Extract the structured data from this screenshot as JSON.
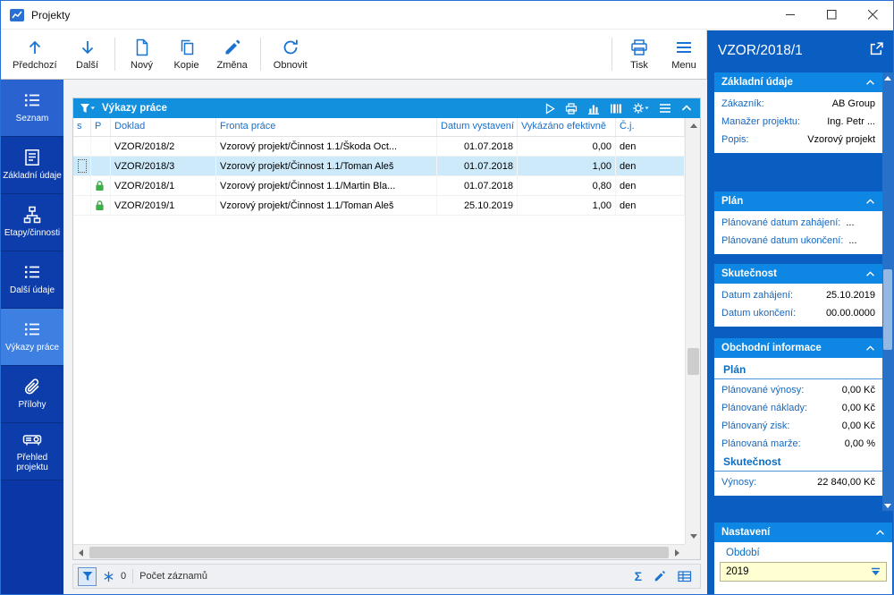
{
  "window": {
    "title": "Projekty"
  },
  "toolbar": {
    "prev_label": "Předchozí",
    "next_label": "Další",
    "new_label": "Nový",
    "copy_label": "Kopie",
    "change_label": "Změna",
    "refresh_label": "Obnovit",
    "print_label": "Tisk",
    "menu_label": "Menu"
  },
  "sidebar": {
    "items": [
      {
        "label": "Seznam"
      },
      {
        "label": "Základní údaje"
      },
      {
        "label": "Etapy/činnosti"
      },
      {
        "label": "Další údaje"
      },
      {
        "label": "Výkazy práce"
      },
      {
        "label": "Přílohy"
      },
      {
        "label": "Přehled projektu"
      }
    ]
  },
  "grid": {
    "title": "Výkazy práce",
    "columns": {
      "s": "s",
      "p": "P",
      "doklad": "Doklad",
      "fronta": "Fronta práce",
      "datum": "Datum vystavení",
      "vykazano": "Vykázáno efektivně",
      "cj": "Č.j."
    },
    "rows": [
      {
        "doklad": "VZOR/2018/2",
        "fronta": "Vzorový projekt/Činnost 1.1/Škoda Oct...",
        "datum": "01.07.2018",
        "vykazano": "0,00",
        "cj": "den"
      },
      {
        "doklad": "VZOR/2018/3",
        "fronta": "Vzorový projekt/Činnost 1.1/Toman Aleš",
        "datum": "01.07.2018",
        "vykazano": "1,00",
        "cj": "den"
      },
      {
        "doklad": "VZOR/2018/1",
        "fronta": "Vzorový projekt/Činnost 1.1/Martin Bla...",
        "datum": "01.07.2018",
        "vykazano": "0,80",
        "cj": "den"
      },
      {
        "doklad": "VZOR/2019/1",
        "fronta": "Vzorový projekt/Činnost 1.1/Toman Aleš",
        "datum": "25.10.2019",
        "vykazano": "1,00",
        "cj": "den"
      }
    ]
  },
  "statusbar": {
    "filter_count": "0",
    "records_label": "Počet záznamů"
  },
  "detail": {
    "title": "VZOR/2018/1",
    "zakladni": {
      "header": "Základní údaje",
      "rows": [
        {
          "label": "Zákazník:",
          "value": "AB Group"
        },
        {
          "label": "Manažer projektu:",
          "value": "Ing. Petr ..."
        },
        {
          "label": "Popis:",
          "value": "Vzorový projekt"
        }
      ]
    },
    "plan": {
      "header": "Plán",
      "rows": [
        {
          "label": "Plánované datum zahájení:",
          "value": "..."
        },
        {
          "label": "Plánované datum ukončení:",
          "value": "..."
        }
      ]
    },
    "skutecnost": {
      "header": "Skutečnost",
      "rows": [
        {
          "label": "Datum zahájení:",
          "value": "25.10.2019"
        },
        {
          "label": "Datum ukončení:",
          "value": "00.00.0000"
        }
      ]
    },
    "obchodni": {
      "header": "Obchodní informace",
      "plan_subheader": "Plán",
      "plan_rows": [
        {
          "label": "Plánované výnosy:",
          "value": "0,00 Kč"
        },
        {
          "label": "Plánované náklady:",
          "value": "0,00 Kč"
        },
        {
          "label": "Plánovaný zisk:",
          "value": "0,00 Kč"
        },
        {
          "label": "Plánovaná marže:",
          "value": "0,00 %"
        }
      ],
      "skutecnost_subheader": "Skutečnost",
      "skutecnost_rows": [
        {
          "label": "Výnosy:",
          "value": "22 840,00 Kč"
        }
      ]
    },
    "nastaveni": {
      "header": "Nastavení",
      "obdobi_label": "Období",
      "obdobi_value": "2019"
    }
  },
  "colors": {
    "accent_blue": "#1a73d1",
    "panel_blue": "#0a5ec2",
    "section_header_blue": "#0e86e3",
    "sidebar_blue": "#0a36a6",
    "active_item_blue": "#3d80e2",
    "selected_row_blue": "#cdeafb",
    "lock_green": "#3fae49",
    "combo_yellow": "#ffffd2"
  }
}
